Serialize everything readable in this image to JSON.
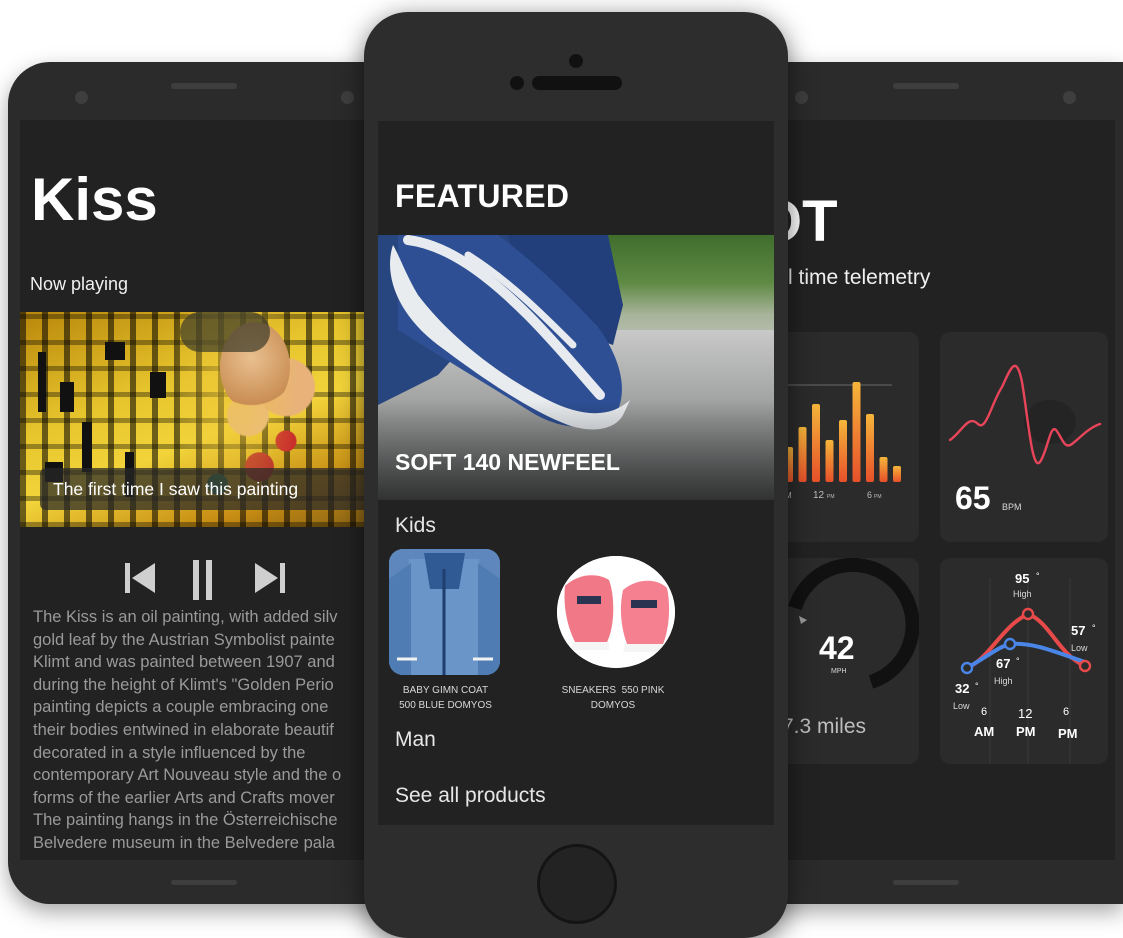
{
  "left_app": {
    "title": "Kiss",
    "now_playing_label": "Now playing",
    "caption": "The first time I saw this painting",
    "controls": {
      "previous_icon": "skip-previous-icon",
      "pause_icon": "pause-icon",
      "next_icon": "skip-next-icon"
    },
    "description": "The Kiss is an oil painting, with added silv\ngold leaf by the Austrian Symbolist painte\nKlimt and was painted between 1907 and\nduring the height of Klimt's \"Golden Perio\npainting depicts a couple embracing one\ntheir bodies entwined in elaborate beautif\ndecorated in a style influenced by the\ncontemporary Art Nouveau style and the o\nforms of the earlier Arts and Crafts mover\nThe painting hangs in the Österreichische\nBelvedere museum in the Belvedere pala"
  },
  "center_app": {
    "featured_title": "FEATURED",
    "hero_product": "SOFT 140 NEWFEEL",
    "sections": {
      "kids": "Kids",
      "man": "Man"
    },
    "products": [
      {
        "line1": "BABY GIMN COAT",
        "line2": "500 BLUE DOMYOS"
      },
      {
        "line1": "SNEAKERS  550 PINK",
        "line2": "DOMYOS"
      }
    ],
    "see_all": "See all products"
  },
  "right_app": {
    "title": "OT",
    "subtitle": "l time telemetry",
    "bar_card": {
      "tick_left": "M",
      "tick_mid": "12",
      "tick_mid_unit": "PM",
      "tick_right": "6",
      "tick_right_unit": "PM",
      "bars": [
        0.35,
        0.55,
        0.78,
        0.42,
        0.62,
        1.0,
        0.68,
        0.25,
        0.16
      ]
    },
    "heart_card": {
      "value": "65",
      "unit": "BPM"
    },
    "speed_card": {
      "value": "42",
      "unit": "MPH",
      "distance": "7.3 miles",
      "gauge_fraction": 0.6
    },
    "temp_card": {
      "high_value": "95",
      "high_label": "High",
      "low_right_value": "57",
      "low_right_label": "Low",
      "mid_value": "67",
      "mid_label": "High",
      "low_left_value": "32",
      "low_left_label": "Low",
      "degree": "°",
      "ticks": [
        {
          "num": "6",
          "unit": "AM"
        },
        {
          "num": "12",
          "unit": "PM"
        },
        {
          "num": "6",
          "unit": "PM"
        }
      ]
    }
  },
  "colors": {
    "screen_bg": "#222222",
    "card_bg": "#2b2b2b",
    "accent_orange": "#f08a24",
    "accent_pink": "#e8455a",
    "accent_blue": "#4a86e8",
    "accent_red": "#e84a4a"
  }
}
